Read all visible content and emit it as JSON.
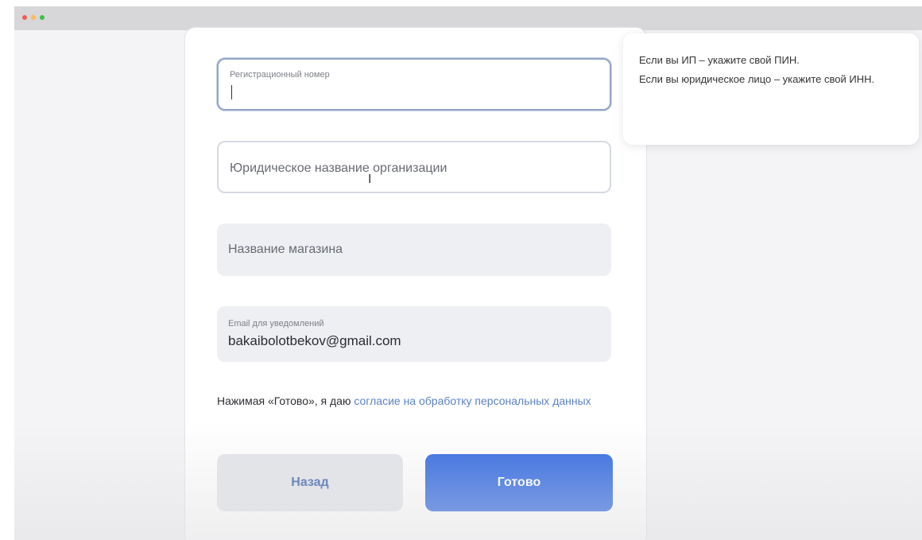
{
  "form": {
    "reg_number": {
      "label": "Регистрационный номер",
      "value": ""
    },
    "legal_name": {
      "placeholder": "Юридическое название организации"
    },
    "shop_name": {
      "placeholder": "Название магазина"
    },
    "email": {
      "label": "Email для уведомлений",
      "value": "bakaibolotbekov@gmail.com"
    },
    "consent": {
      "text": "Нажимая «Готово», я даю ",
      "link": "согласие на обработку персональных данных"
    },
    "back_label": "Назад",
    "done_label": "Готово"
  },
  "tooltip": {
    "line1": "Если вы ИП – укажите свой ПИН.",
    "line2": "Если вы юридическое лицо – укажите свой ИНН."
  },
  "colors": {
    "primary": "#2f67e0",
    "link": "#5b82c8"
  },
  "icons": {
    "cursor": "i-beam-cursor-icon"
  }
}
